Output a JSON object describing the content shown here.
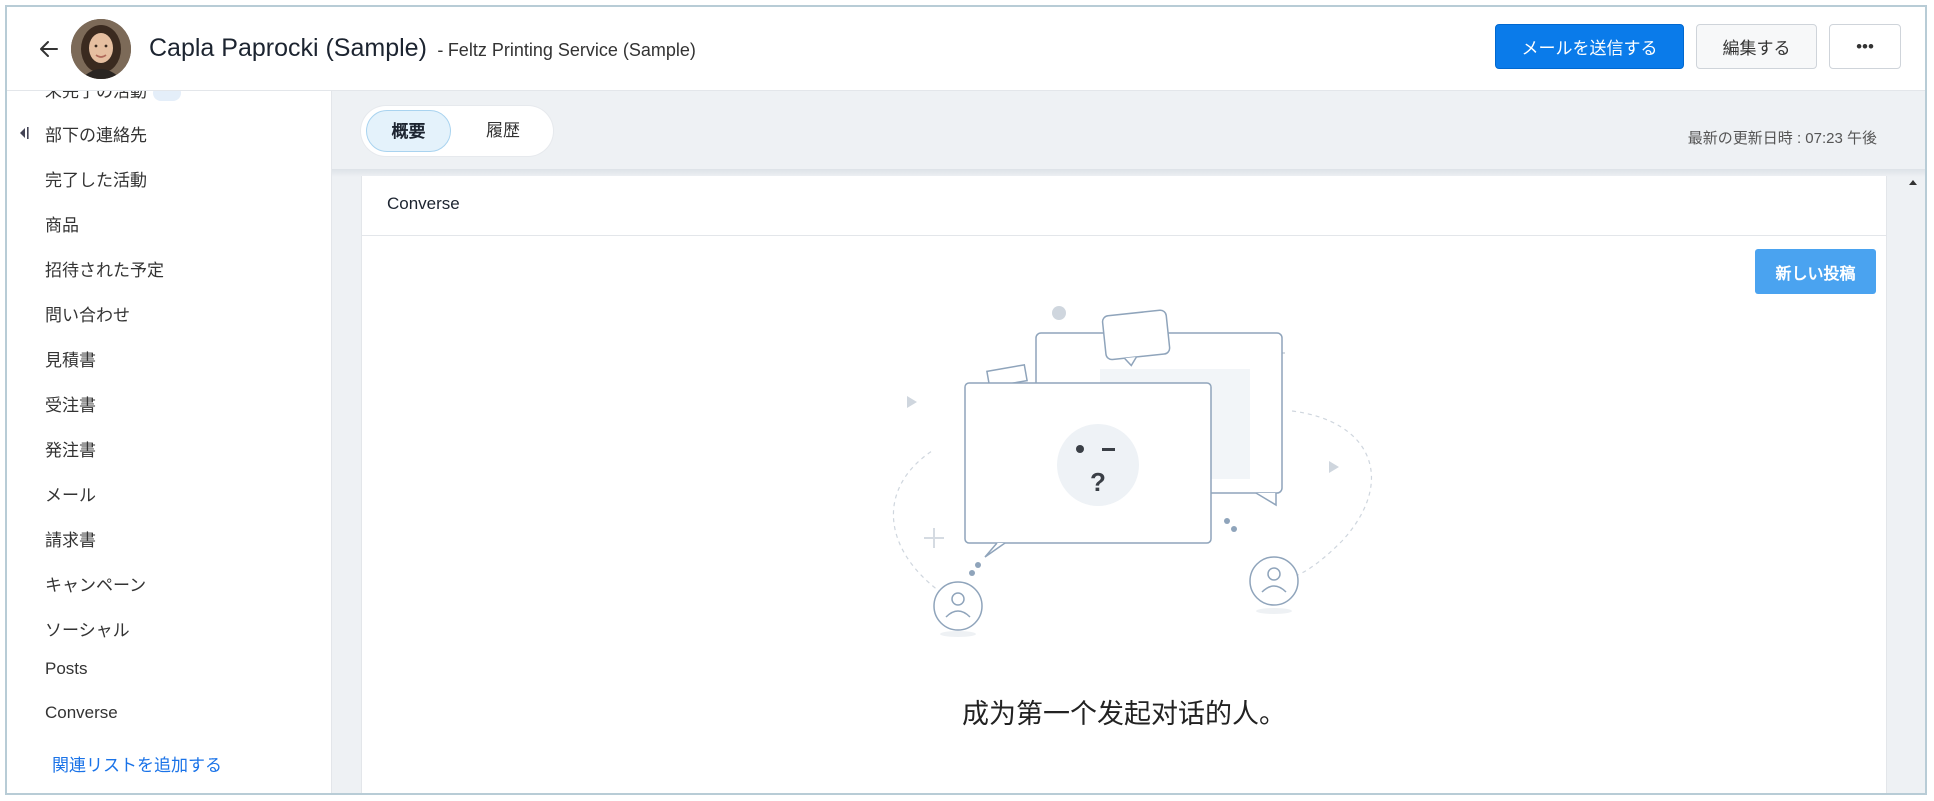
{
  "header": {
    "contact_name": "Capla Paprocki (Sample)",
    "separator": "-",
    "company": "Feltz Printing Service (Sample)",
    "send_email_label": "メールを送信する",
    "edit_label": "編集する",
    "more_label": "•••"
  },
  "sidebar": {
    "partial_item": "未完了の活動",
    "items": [
      {
        "label": "部下の連絡先"
      },
      {
        "label": "完了した活動"
      },
      {
        "label": "商品"
      },
      {
        "label": "招待された予定"
      },
      {
        "label": "問い合わせ"
      },
      {
        "label": "見積書"
      },
      {
        "label": "受注書"
      },
      {
        "label": "発注書"
      },
      {
        "label": "メール"
      },
      {
        "label": "請求書"
      },
      {
        "label": "キャンペーン"
      },
      {
        "label": "ソーシャル"
      },
      {
        "label": "Posts"
      },
      {
        "label": "Converse"
      }
    ],
    "add_related_list": "関連リストを追加する"
  },
  "main": {
    "tabs": [
      {
        "label": "概要",
        "active": true
      },
      {
        "label": "履歴",
        "active": false
      }
    ],
    "last_updated": "最新の更新日時 : 07:23 午後",
    "panel": {
      "title": "Converse",
      "new_post_label": "新しい投稿",
      "empty_message": "成为第一个发起对话的人。"
    }
  },
  "colors": {
    "primary": "#0a7bea",
    "new_post": "#4aa3f0",
    "link": "#1a73e8",
    "tab_active_bg": "#e4f2fb",
    "main_bg": "#eef1f4"
  }
}
